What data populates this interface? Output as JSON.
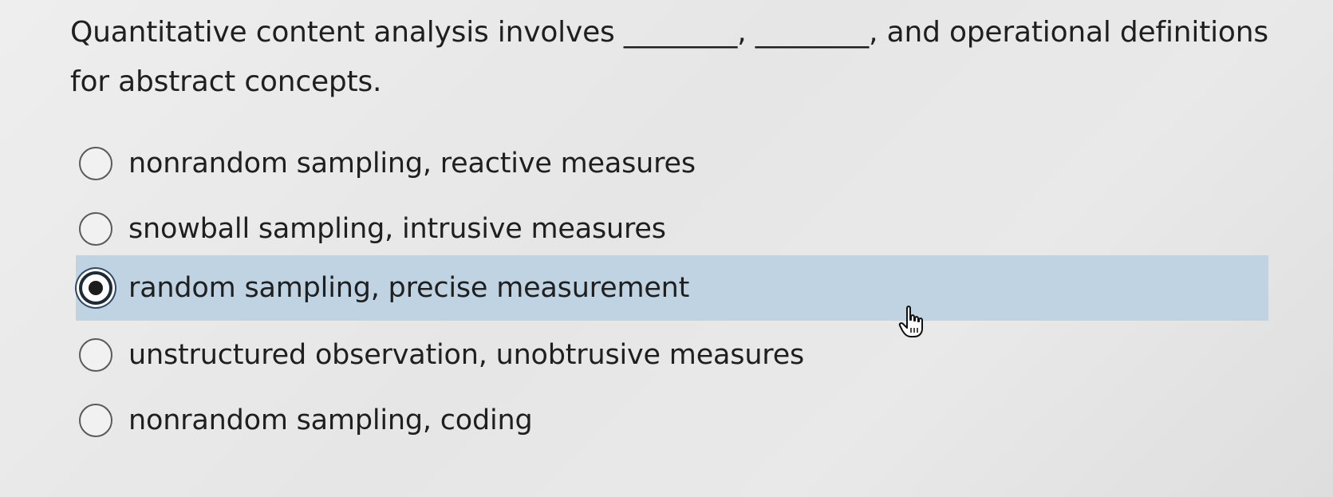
{
  "question": {
    "text": "Quantitative content analysis involves ________, ________, and operational definitions for abstract concepts."
  },
  "options": [
    {
      "label": "nonrandom sampling, reactive measures",
      "selected": false
    },
    {
      "label": "snowball sampling, intrusive measures",
      "selected": false
    },
    {
      "label": "random sampling, precise measurement",
      "selected": true
    },
    {
      "label": "unstructured observation, unobtrusive measures",
      "selected": false
    },
    {
      "label": "nonrandom sampling, coding",
      "selected": false
    }
  ],
  "colors": {
    "selected_background": "#bfd3e2",
    "radio_border": "#5a5a5a",
    "text": "#1f1f1f"
  },
  "icons": {
    "cursor": "hand-pointer-icon"
  }
}
